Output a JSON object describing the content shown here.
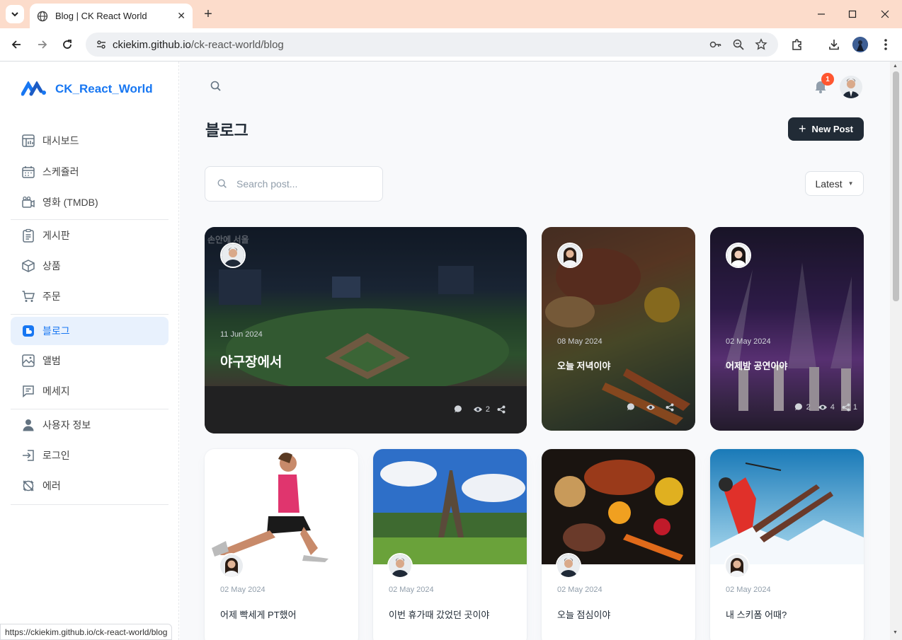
{
  "browser": {
    "tab_title": "Blog | CK React World",
    "url_host": "ckiekim.github.io",
    "url_path": "/ck-react-world/blog",
    "status_url": "https://ckiekim.github.io/ck-react-world/blog"
  },
  "sidebar": {
    "brand": "CK_React_World",
    "items": [
      {
        "label": "대시보드",
        "icon": "dashboard-icon"
      },
      {
        "label": "스케쥴러",
        "icon": "calendar-icon"
      },
      {
        "label": "영화 (TMDB)",
        "icon": "video-camera-icon"
      },
      {
        "label": "게시판",
        "icon": "clipboard-icon"
      },
      {
        "label": "상품",
        "icon": "box-icon"
      },
      {
        "label": "주문",
        "icon": "cart-icon"
      },
      {
        "label": "블로그",
        "icon": "blogger-icon"
      },
      {
        "label": "앨범",
        "icon": "image-icon"
      },
      {
        "label": "메세지",
        "icon": "message-icon"
      },
      {
        "label": "사용자 정보",
        "icon": "user-icon"
      },
      {
        "label": "로그인",
        "icon": "login-icon"
      },
      {
        "label": "에러",
        "icon": "error-icon"
      }
    ]
  },
  "header": {
    "notification_count": "1"
  },
  "page": {
    "title": "블로그",
    "new_post_label": "New Post",
    "search_placeholder": "Search post...",
    "sort_label": "Latest"
  },
  "colors": {
    "accent": "#1877f2",
    "dark_button": "#212b36",
    "badge": "#ff5630"
  },
  "posts": [
    {
      "date": "11 Jun 2024",
      "title": "야구장에서",
      "comments": "",
      "views": "2",
      "shares": "",
      "image_caption": "손안에 서울"
    },
    {
      "date": "08 May 2024",
      "title": "오늘 저녁이야",
      "comments": "",
      "views": "",
      "shares": ""
    },
    {
      "date": "02 May 2024",
      "title": "어제밤 공연이야",
      "comments": "2",
      "views": "4",
      "shares": "1"
    },
    {
      "date": "02 May 2024",
      "title": "어제 빡세게 PT했어"
    },
    {
      "date": "02 May 2024",
      "title": "이번 휴가때 갔었던 곳이야"
    },
    {
      "date": "02 May 2024",
      "title": "오늘 점심이야"
    },
    {
      "date": "02 May 2024",
      "title": "내 스키폼 어때?"
    }
  ]
}
